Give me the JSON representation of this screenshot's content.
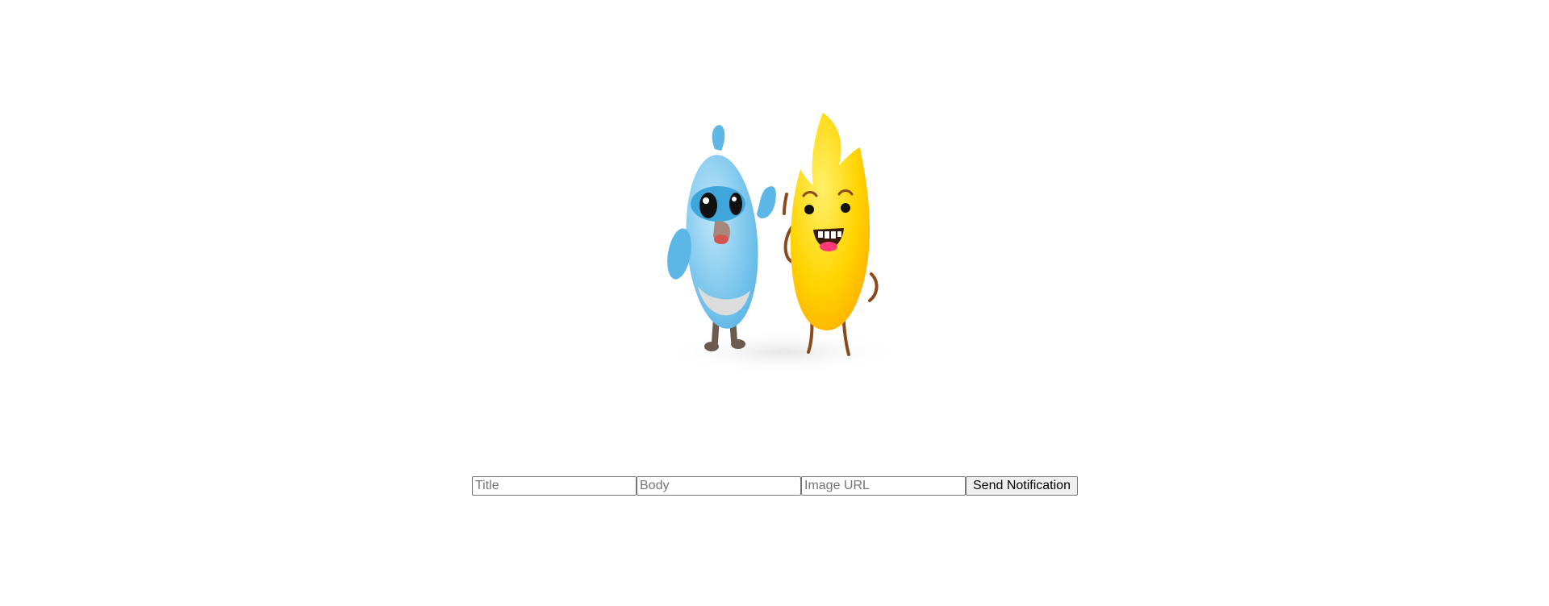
{
  "hero": {
    "description": ""
  },
  "form": {
    "title_placeholder": "Title",
    "title_value": "",
    "body_placeholder": "Body",
    "body_value": "",
    "image_url_placeholder": "Image URL",
    "image_url_value": "",
    "send_label": "Send Notification"
  },
  "colors": {
    "background": "#ffffff",
    "bird_blue": "#7cc8ec",
    "bird_dark_blue": "#3fa6dc",
    "flame_yellow": "#ffd400",
    "flame_orange": "#ffb300"
  }
}
